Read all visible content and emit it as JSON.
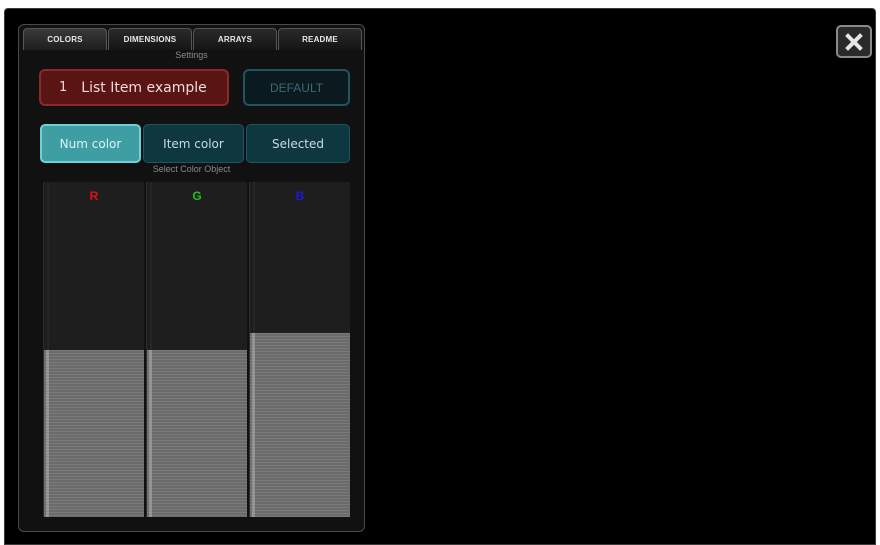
{
  "tabs": [
    {
      "label": "COLORS",
      "active": true
    },
    {
      "label": "DIMENSIONS",
      "active": false
    },
    {
      "label": "ARRAYS",
      "active": false
    },
    {
      "label": "README",
      "active": false
    }
  ],
  "settings_caption": "Settings",
  "list_item": {
    "number": "1",
    "text": "List Item example"
  },
  "default_label": "DEFAULT",
  "color_objects": [
    {
      "label": "Num color",
      "selected": true
    },
    {
      "label": "Item color",
      "selected": false
    },
    {
      "label": "Selected",
      "selected": false
    }
  ],
  "select_caption": "Select Color Object",
  "sliders": [
    {
      "label": "R",
      "color": "#e01010",
      "value_fraction": 0.5
    },
    {
      "label": "G",
      "color": "#18c818",
      "value_fraction": 0.5
    },
    {
      "label": "B",
      "color": "#1a1ad8",
      "value_fraction": 0.55
    }
  ],
  "icons": {
    "close": "close-icon"
  }
}
